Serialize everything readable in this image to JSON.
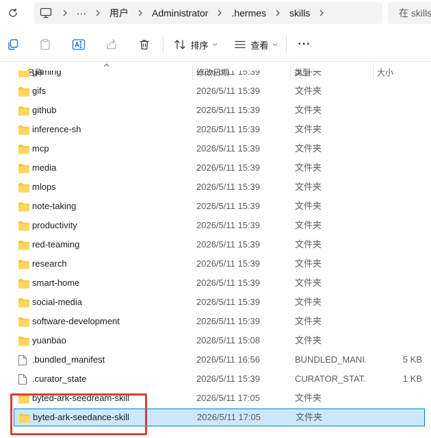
{
  "breadcrumb": {
    "overflow": "···",
    "items": [
      "用户",
      "Administrator",
      ".hermes",
      "skills"
    ]
  },
  "search": {
    "placeholder": "在 skills"
  },
  "toolbar": {
    "sort_label": "排序",
    "view_label": "查看",
    "more_label": "···"
  },
  "columns": {
    "name": "名称",
    "date": "修改日期",
    "type": "类型",
    "size": "大小"
  },
  "files": [
    {
      "name": "gaming",
      "date": "2026/5/11 15:39",
      "type": "文件夹",
      "size": "",
      "kind": "folder"
    },
    {
      "name": "gifs",
      "date": "2026/5/11 15:39",
      "type": "文件夹",
      "size": "",
      "kind": "folder"
    },
    {
      "name": "github",
      "date": "2026/5/11 15:39",
      "type": "文件夹",
      "size": "",
      "kind": "folder"
    },
    {
      "name": "inference-sh",
      "date": "2026/5/11 15:39",
      "type": "文件夹",
      "size": "",
      "kind": "folder"
    },
    {
      "name": "mcp",
      "date": "2026/5/11 15:39",
      "type": "文件夹",
      "size": "",
      "kind": "folder"
    },
    {
      "name": "media",
      "date": "2026/5/11 15:39",
      "type": "文件夹",
      "size": "",
      "kind": "folder"
    },
    {
      "name": "mlops",
      "date": "2026/5/11 15:39",
      "type": "文件夹",
      "size": "",
      "kind": "folder"
    },
    {
      "name": "note-taking",
      "date": "2026/5/11 15:39",
      "type": "文件夹",
      "size": "",
      "kind": "folder"
    },
    {
      "name": "productivity",
      "date": "2026/5/11 15:39",
      "type": "文件夹",
      "size": "",
      "kind": "folder"
    },
    {
      "name": "red-teaming",
      "date": "2026/5/11 15:39",
      "type": "文件夹",
      "size": "",
      "kind": "folder"
    },
    {
      "name": "research",
      "date": "2026/5/11 15:39",
      "type": "文件夹",
      "size": "",
      "kind": "folder"
    },
    {
      "name": "smart-home",
      "date": "2026/5/11 15:39",
      "type": "文件夹",
      "size": "",
      "kind": "folder"
    },
    {
      "name": "social-media",
      "date": "2026/5/11 15:39",
      "type": "文件夹",
      "size": "",
      "kind": "folder"
    },
    {
      "name": "software-development",
      "date": "2026/5/11 15:39",
      "type": "文件夹",
      "size": "",
      "kind": "folder"
    },
    {
      "name": "yuanbao",
      "date": "2026/5/11 15:08",
      "type": "文件夹",
      "size": "",
      "kind": "folder"
    },
    {
      "name": ".bundled_manifest",
      "date": "2026/5/11 16:56",
      "type": "BUNDLED_MANI...",
      "size": "5 KB",
      "kind": "file"
    },
    {
      "name": ".curator_state",
      "date": "2026/5/11 15:39",
      "type": "CURATOR_STAT...",
      "size": "1 KB",
      "kind": "file"
    },
    {
      "name": "byted-ark-seedream-skill",
      "date": "2026/5/11 17:05",
      "type": "文件夹",
      "size": "",
      "kind": "folder"
    },
    {
      "name": "byted-ark-seedance-skill",
      "date": "2026/5/11 17:05",
      "type": "文件夹",
      "size": "",
      "kind": "folder",
      "selected": true
    }
  ],
  "colors": {
    "folder": "#f8c940",
    "selection": "#cce8ff",
    "selection_border": "#0078d7",
    "highlight": "#e53935"
  }
}
